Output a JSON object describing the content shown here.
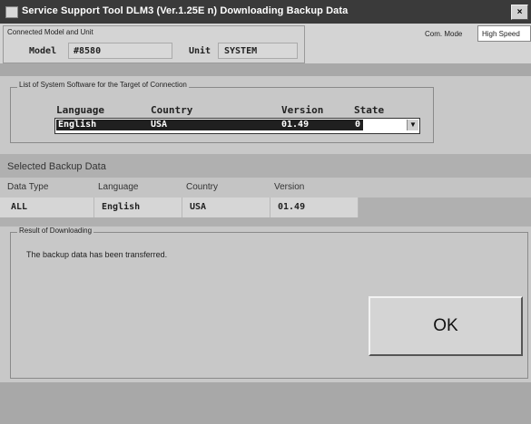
{
  "window": {
    "title": "Service Support Tool DLM3 (Ver.1.25E n) Downloading Backup Data",
    "close_label": "×"
  },
  "connection": {
    "group_label": "Connected Model and Unit",
    "model_label": "Model",
    "model_value": "#8580",
    "unit_label": "Unit",
    "unit_value": "SYSTEM",
    "com_mode_label": "Com. Mode",
    "com_mode_value": "High Speed"
  },
  "software": {
    "group_label": "List of System Software for the Target of Connection",
    "columns": [
      "Language",
      "Country",
      "Version",
      "State"
    ],
    "selected_row": [
      "English",
      "USA",
      "01.49",
      "0"
    ],
    "dropdown_icon": "▼"
  },
  "backup": {
    "title": "Selected Backup Data",
    "headers": [
      "Data Type",
      "Language",
      "Country",
      "Version"
    ],
    "values": [
      "ALL",
      "English",
      "USA",
      "01.49"
    ]
  },
  "result": {
    "group_label": "Result of Downloading",
    "message": "The backup data has been transferred.",
    "ok_label": "OK"
  }
}
